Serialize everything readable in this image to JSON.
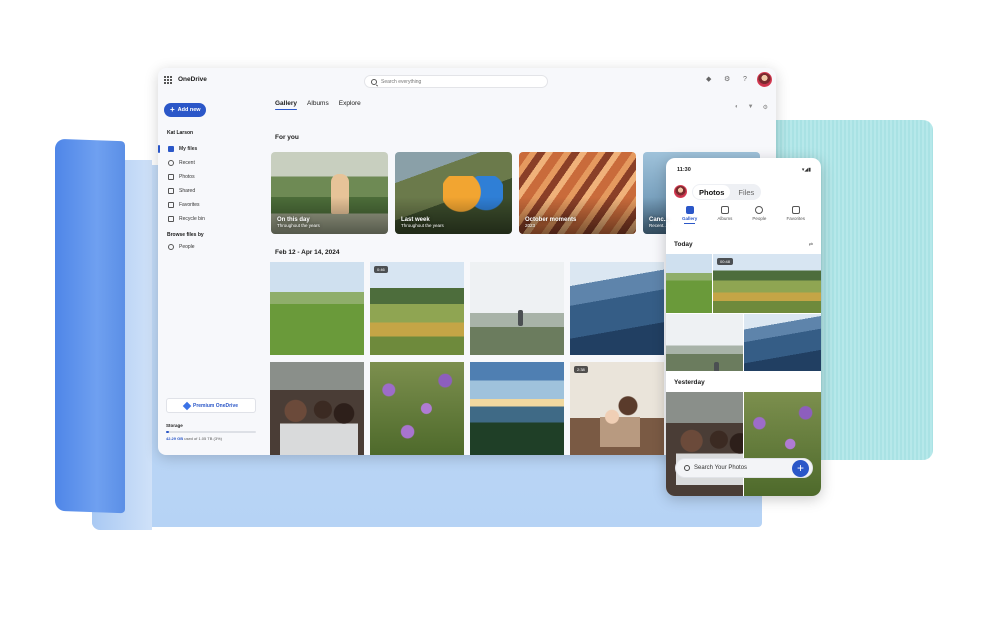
{
  "app": {
    "name": "OneDrive"
  },
  "search": {
    "placeholder": "Search everything"
  },
  "sidebar": {
    "add_new": "Add new",
    "user": "Kat Larson",
    "items": [
      {
        "label": "My files",
        "icon": "folder-icon"
      },
      {
        "label": "Recent",
        "icon": "clock-icon"
      },
      {
        "label": "Photos",
        "icon": "image-icon"
      },
      {
        "label": "Shared",
        "icon": "people-icon"
      },
      {
        "label": "Favorites",
        "icon": "star-icon"
      },
      {
        "label": "Recycle bin",
        "icon": "trash-icon"
      }
    ],
    "browse_label": "Browse files by",
    "browse_items": [
      {
        "label": "People",
        "icon": "person-icon"
      }
    ],
    "premium": "Premium OneDrive",
    "storage_label": "Storage",
    "storage_used": "42.29 GB",
    "storage_rest": " used of 1.05 TB (3%)",
    "storage_fraction": 0.03
  },
  "main": {
    "tabs": [
      "Gallery",
      "Albums",
      "Explore"
    ],
    "for_you": "For you",
    "cards": [
      {
        "title": "On this day",
        "subtitle": "Throughout the years"
      },
      {
        "title": "Last week",
        "subtitle": "Throughout the years"
      },
      {
        "title": "October moments",
        "subtitle": "2023"
      },
      {
        "title": "Canc...",
        "subtitle": "Recent..."
      }
    ],
    "date_range": "Feb 12 - Apr 14, 2024",
    "badges": {
      "terrace": "0:46",
      "baby": "2:38"
    }
  },
  "phone": {
    "time": "11:30",
    "segments": [
      "Photos",
      "Files"
    ],
    "nav": [
      "Gallery",
      "Albums",
      "People",
      "Favorites"
    ],
    "today": "Today",
    "video_badge": "00:48",
    "yesterday": "Yesterday",
    "search_placeholder": "Search Your Photos"
  },
  "colors": {
    "accent": "#2b57c8"
  }
}
